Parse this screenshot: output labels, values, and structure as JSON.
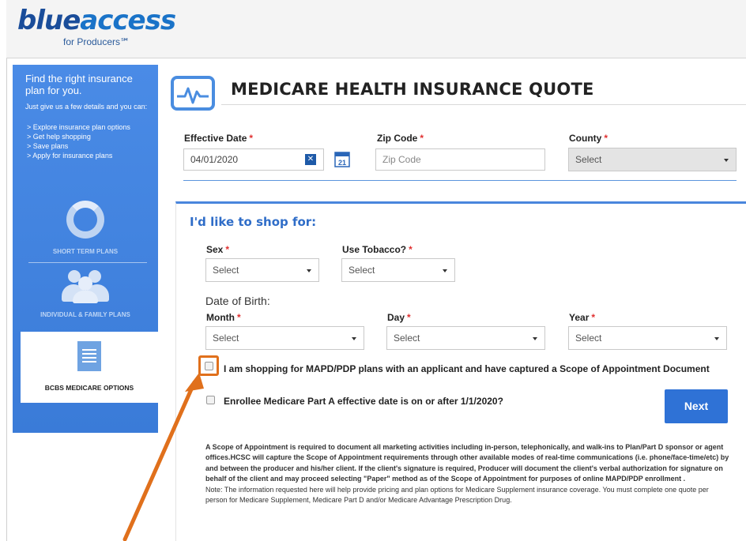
{
  "logo": {
    "brand_a": "blue",
    "brand_b": "access",
    "sub": "for Producers℠"
  },
  "sidebar": {
    "heading": "Find the right insurance plan for you.",
    "subheading": "Just give us a few details and you can:",
    "items": [
      "Explore insurance plan options",
      "Get help shopping",
      "Save plans",
      "Apply for insurance plans"
    ],
    "plans": [
      {
        "label": "SHORT TERM PLANS",
        "icon": "ring-icon"
      },
      {
        "label": "INDIVIDUAL & FAMILY PLANS",
        "icon": "people-icon"
      },
      {
        "label": "BCBS MEDICARE OPTIONS",
        "icon": "medicare-doc-icon"
      }
    ]
  },
  "page": {
    "title": "MEDICARE HEALTH INSURANCE QUOTE"
  },
  "form": {
    "effective_date": {
      "label": "Effective Date",
      "value": "04/01/2020"
    },
    "zip": {
      "label": "Zip Code",
      "placeholder": "Zip Code"
    },
    "county": {
      "label": "County",
      "value": "Select"
    },
    "req": "*"
  },
  "shop": {
    "title": "I'd like to shop for:",
    "sex": {
      "label": "Sex",
      "value": "Select"
    },
    "tobacco": {
      "label": "Use Tobacco?",
      "value": "Select"
    },
    "dob_label": "Date of Birth:",
    "month": {
      "label": "Month",
      "value": "Select"
    },
    "day": {
      "label": "Day",
      "value": "Select"
    },
    "year": {
      "label": "Year",
      "value": "Select"
    },
    "checkbox_1": "I am shopping for MAPD/PDP plans with an applicant and have captured a Scope of Appointment Document",
    "checkbox_2": "Enrollee Medicare Part A effective date is on or after 1/1/2020?",
    "next": "Next"
  },
  "disclaimer": {
    "p1": "A Scope of Appointment is required to document all marketing activities including in-person, telephonically, and walk-ins to Plan/Part D sponsor or agent offices.HCSC will capture the Scope of Appointment requirements through other available modes of real-time communications (i.e. phone/face-time/etc) by and between the producer and his/her client. If the client's signature is required, Producer will document the client's verbal authorization for signature on behalf of the client and may proceed selecting \"Paper\" method as of the Scope of Appointment for purposes of online MAPD/PDP enrollment .",
    "p2": "Note: The information requested here will help provide pricing and plan options for Medicare Supplement insurance coverage. You must complete one quote per person for Medicare Supplement, Medicare Part D and/or Medicare Advantage Prescription Drug."
  },
  "colors": {
    "accent": "#2f72d6",
    "sidebar": "#4a8be6",
    "annotation": "#e0701c"
  }
}
